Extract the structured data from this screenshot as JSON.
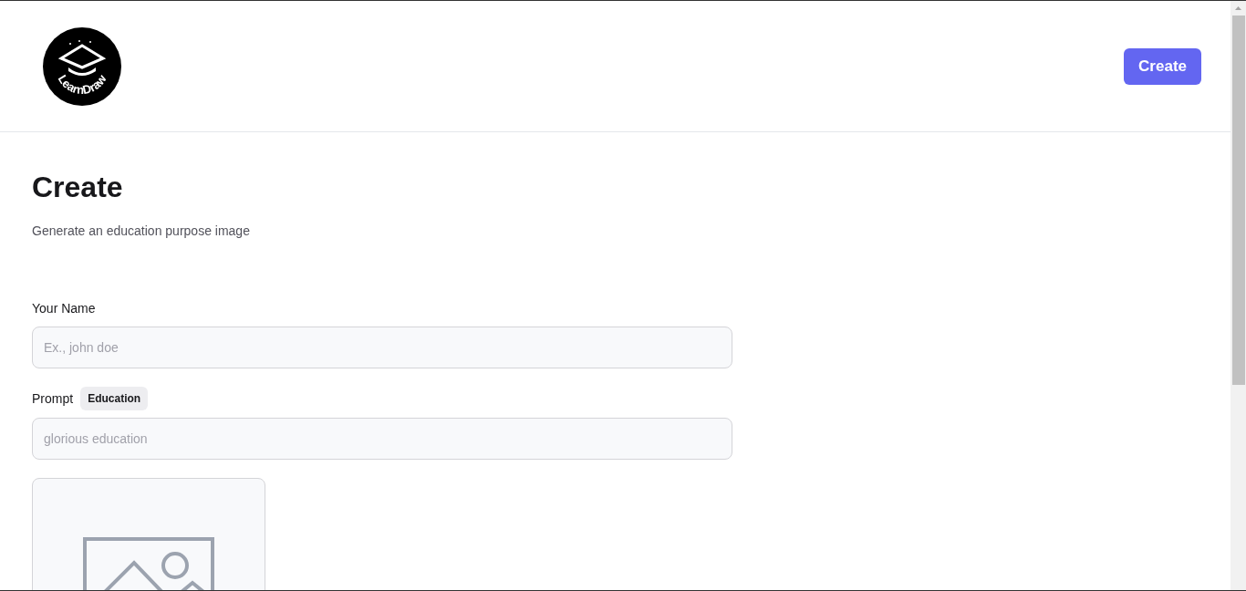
{
  "header": {
    "logo_text": "LearnDraw",
    "button": "Create"
  },
  "page": {
    "title": "Create",
    "subtitle": "Generate an education purpose image"
  },
  "form": {
    "name_label": "Your Name",
    "name_placeholder": "Ex., john doe",
    "prompt_label": "Prompt",
    "prompt_tag": "Education",
    "prompt_placeholder": "glorious education",
    "image": {
      "kind": "placeholder"
    }
  }
}
